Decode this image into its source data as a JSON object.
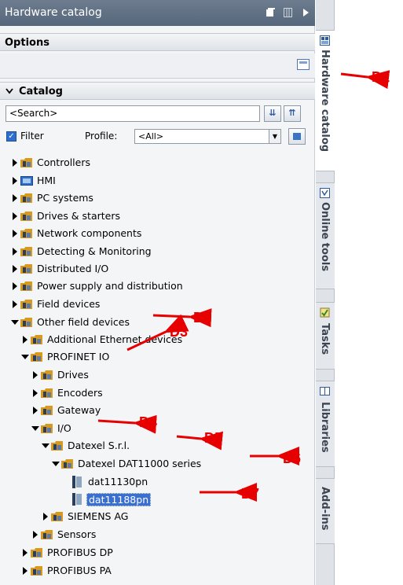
{
  "titlebar": {
    "title": "Hardware catalog"
  },
  "options": {
    "title": "Options"
  },
  "catalog": {
    "title": "Catalog",
    "search_value": "<Search>",
    "filter_label": "Filter",
    "profile_label": "Profile:",
    "profile_value": "<All>"
  },
  "tree": [
    {
      "label": "Controllers"
    },
    {
      "label": "HMI"
    },
    {
      "label": "PC systems"
    },
    {
      "label": "Drives & starters"
    },
    {
      "label": "Network components"
    },
    {
      "label": "Detecting & Monitoring"
    },
    {
      "label": "Distributed I/O"
    },
    {
      "label": "Power supply and distribution"
    },
    {
      "label": "Field devices"
    },
    {
      "label": "Other field devices"
    },
    {
      "label": "Additional Ethernet devices"
    },
    {
      "label": "PROFINET IO"
    },
    {
      "label": "Drives"
    },
    {
      "label": "Encoders"
    },
    {
      "label": "Gateway"
    },
    {
      "label": "I/O"
    },
    {
      "label": "Datexel S.r.l."
    },
    {
      "label": "Datexel DAT11000 series"
    },
    {
      "label": "dat11130pn"
    },
    {
      "label": "dat11188pn"
    },
    {
      "label": "SIEMENS AG"
    },
    {
      "label": "Sensors"
    },
    {
      "label": "PROFIBUS DP"
    },
    {
      "label": "PROFIBUS PA"
    }
  ],
  "side_tabs": [
    {
      "label": "Hardware catalog",
      "icon": "catalog-icon",
      "active": true
    },
    {
      "label": "Online tools",
      "icon": "online-tools-icon"
    },
    {
      "label": "Tasks",
      "icon": "tasks-icon"
    },
    {
      "label": "Libraries",
      "icon": "libraries-icon"
    },
    {
      "label": "Add-ins"
    }
  ],
  "annotations": [
    "D1",
    "D2",
    "D3",
    "D4",
    "D5",
    "D6",
    "D7"
  ],
  "colors": {
    "annotation": "#e60000",
    "titlebar": "#5f6f83",
    "selection": "#3a6fd1",
    "folder": "#d89a1e"
  }
}
